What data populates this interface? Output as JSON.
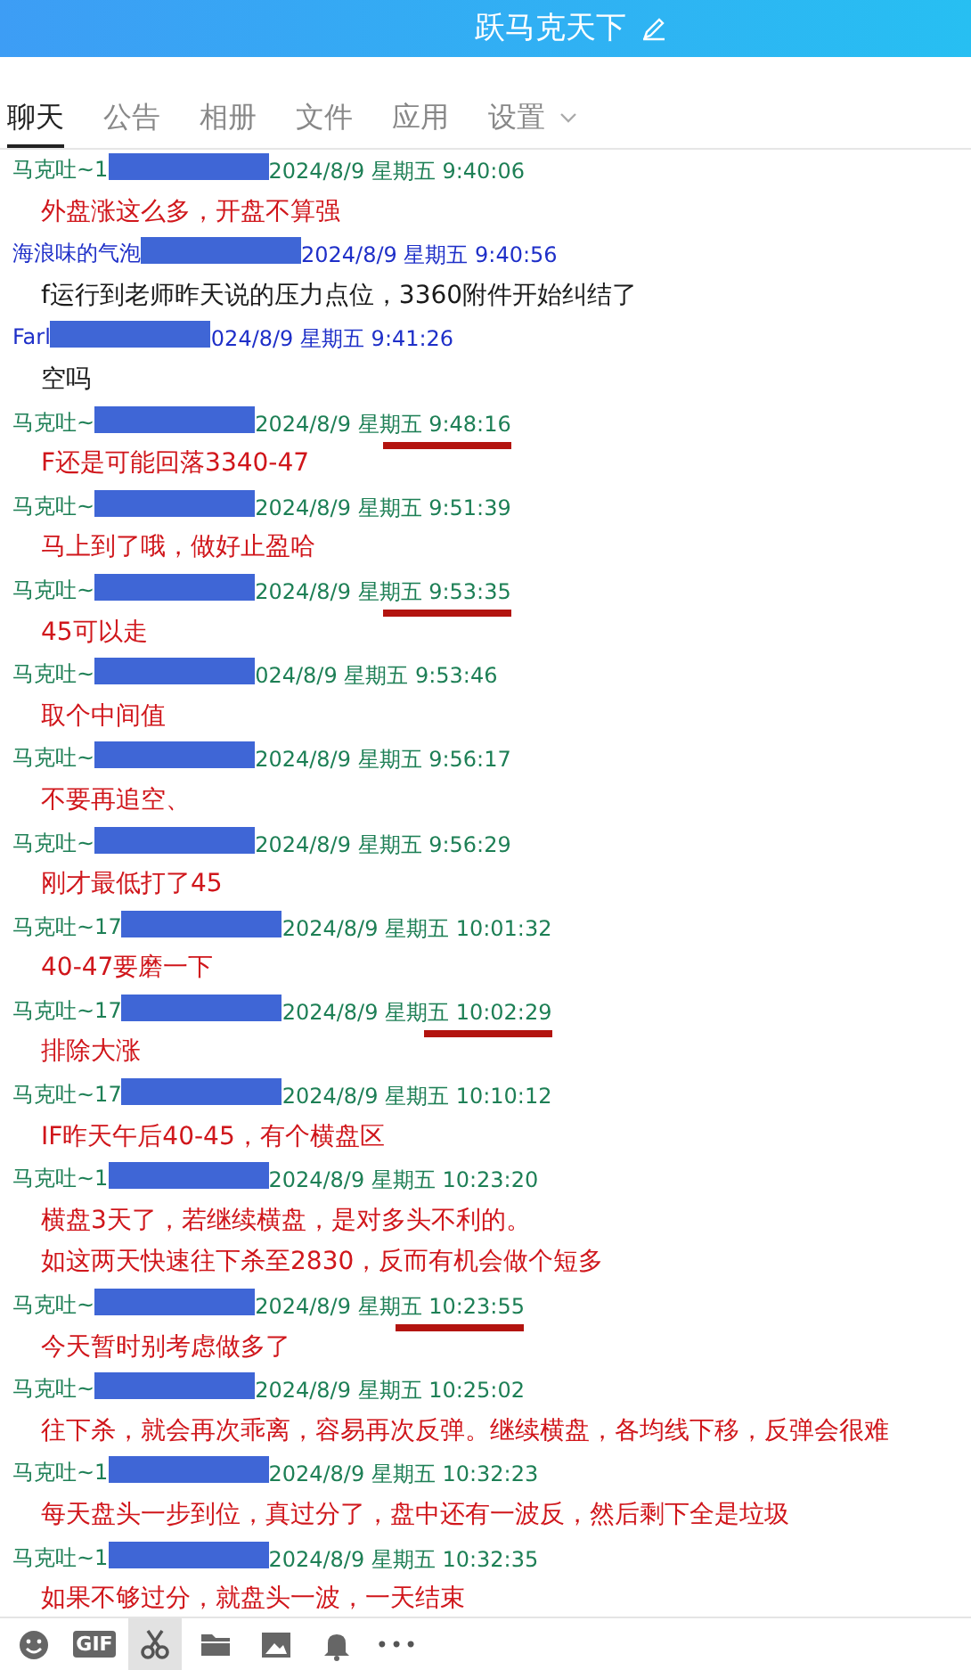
{
  "window": {
    "title": "跃马克天下"
  },
  "tabs": [
    {
      "label": "聊天",
      "selected": true
    },
    {
      "label": "公告",
      "selected": false
    },
    {
      "label": "相册",
      "selected": false
    },
    {
      "label": "文件",
      "selected": false
    },
    {
      "label": "应用",
      "selected": false
    },
    {
      "label": "设置",
      "selected": false,
      "dropdown": true
    }
  ],
  "messages": [
    {
      "sender": "马克吐~1",
      "kind": "member",
      "time": "2024/8/9 星期五 9:40:06",
      "underlined": false,
      "color": "#d0161b",
      "lines": [
        "外盘涨这么多，开盘不算强"
      ]
    },
    {
      "sender": "海浪味的气泡",
      "kind": "guest",
      "time": "2024/8/9 星期五 9:40:56",
      "underlined": false,
      "color": "#1a1a1a",
      "lines": [
        "f运行到老师昨天说的压力点位，3360附件开始纠结了"
      ]
    },
    {
      "sender": "Farl",
      "kind": "guest",
      "time": "024/8/9 星期五 9:41:26",
      "underlined": false,
      "color": "#1a1a1a",
      "lines": [
        "空吗"
      ]
    },
    {
      "sender": "马克吐~",
      "kind": "member",
      "time": "2024/8/9 星期五 9:48:16",
      "underlined": true,
      "color": "#d0161b",
      "lines": [
        "F还是可能回落3340-47"
      ]
    },
    {
      "sender": "马克吐~",
      "kind": "member",
      "time": "2024/8/9 星期五 9:51:39",
      "underlined": false,
      "color": "#d0161b",
      "lines": [
        "马上到了哦，做好止盈哈"
      ]
    },
    {
      "sender": "马克吐~",
      "kind": "member",
      "time": "2024/8/9 星期五 9:53:35",
      "underlined": true,
      "color": "#d0161b",
      "lines": [
        "45可以走"
      ]
    },
    {
      "sender": "马克吐~",
      "kind": "member",
      "time": "024/8/9 星期五 9:53:46",
      "underlined": false,
      "color": "#d0161b",
      "lines": [
        "取个中间值"
      ]
    },
    {
      "sender": "马克吐~",
      "kind": "member",
      "time": "2024/8/9 星期五 9:56:17",
      "underlined": false,
      "color": "#d0161b",
      "lines": [
        "不要再追空、"
      ]
    },
    {
      "sender": "马克吐~",
      "kind": "member",
      "time": "2024/8/9 星期五 9:56:29",
      "underlined": false,
      "color": "#d0161b",
      "lines": [
        "刚才最低打了45"
      ]
    },
    {
      "sender": "马克吐~17",
      "kind": "member",
      "time": "2024/8/9 星期五 10:01:32",
      "underlined": false,
      "color": "#d0161b",
      "lines": [
        "40-47要磨一下"
      ]
    },
    {
      "sender": "马克吐~17",
      "kind": "member",
      "time": "2024/8/9 星期五 10:02:29",
      "underlined": true,
      "color": "#d0161b",
      "lines": [
        "排除大涨"
      ]
    },
    {
      "sender": "马克吐~17",
      "kind": "member",
      "time": "2024/8/9 星期五 10:10:12",
      "underlined": false,
      "color": "#d0161b",
      "lines": [
        "IF昨天午后40-45，有个横盘区"
      ]
    },
    {
      "sender": "马克吐~1",
      "kind": "member",
      "time": "2024/8/9 星期五 10:23:20",
      "underlined": false,
      "color": "#d0161b",
      "lines": [
        "横盘3天了，若继续横盘，是对多头不利的。",
        "如这两天快速往下杀至2830，反而有机会做个短多"
      ]
    },
    {
      "sender": "马克吐~",
      "kind": "member",
      "time": "2024/8/9 星期五 10:23:55",
      "underlined": true,
      "color": "#d0161b",
      "lines": [
        "今天暂时别考虑做多了"
      ]
    },
    {
      "sender": "马克吐~",
      "kind": "member",
      "time": "2024/8/9 星期五 10:25:02",
      "underlined": false,
      "color": "#d0161b",
      "lines": [
        "往下杀，就会再次乖离，容易再次反弹。继续横盘，各均线下移，反弹会很难"
      ]
    },
    {
      "sender": "马克吐~1",
      "kind": "member",
      "time": "2024/8/9 星期五 10:32:23",
      "underlined": false,
      "color": "#d0161b",
      "lines": [
        "每天盘头一步到位，真过分了，盘中还有一波反，然后剩下全是垃圾"
      ]
    },
    {
      "sender": "马克吐~1",
      "kind": "member",
      "time": "2024/8/9 星期五 10:32:35",
      "underlined": false,
      "color": "#d0161b",
      "lines": [
        "如果不够过分，就盘头一波，一天结束"
      ]
    }
  ],
  "toolbar": [
    {
      "kind": "emoji"
    },
    {
      "kind": "gif",
      "label": "GIF"
    },
    {
      "kind": "scissors",
      "selected": true
    },
    {
      "kind": "folder"
    },
    {
      "kind": "image"
    },
    {
      "kind": "bell"
    },
    {
      "kind": "more",
      "label": "•••"
    }
  ]
}
